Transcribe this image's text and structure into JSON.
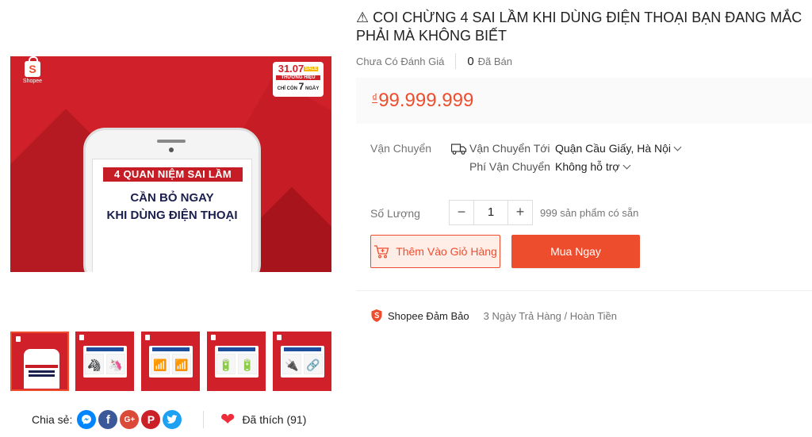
{
  "product": {
    "title": "⚠ COI CHỪNG 4 SAI LẦM KHI DÙNG ĐIỆN THOẠI BẠN ĐANG MẮC PHẢI MÀ KHÔNG BIẾT",
    "rating_text": "Chưa Có Đánh Giá",
    "sold_count": "0",
    "sold_label": "Đã Bán",
    "currency": "₫",
    "price": "99.999.999"
  },
  "image": {
    "logo_label": "Shopee",
    "sale_date": "31.07",
    "sale_tag": "SALE",
    "sale_line1": "THƯƠNG HIỆU",
    "sale_line2": "CHỈ CÒN",
    "sale_days": "7",
    "sale_line3": "NGÀY",
    "headline1": "4 QUAN NIỆM SAI LẦM",
    "headline2": "CẦN BỎ NGAY",
    "headline3": "KHI DÙNG ĐIỆN THOẠI"
  },
  "thumbnails": [
    {
      "icons": [
        "",
        ""
      ],
      "type": "phone"
    },
    {
      "icons": [
        "🦓",
        "🦄"
      ],
      "type": "compare"
    },
    {
      "icons": [
        "📶",
        "📶"
      ],
      "type": "compare"
    },
    {
      "icons": [
        "🔋",
        "🔋"
      ],
      "type": "compare"
    },
    {
      "icons": [
        "🔌",
        "🔗"
      ],
      "type": "compare"
    }
  ],
  "shipping": {
    "label": "Vận Chuyển",
    "to_label": "Vận Chuyển Tới",
    "to_value": "Quận Cầu Giấy, Hà Nội",
    "fee_label": "Phí Vận Chuyển",
    "fee_value": "Không hỗ trợ"
  },
  "quantity": {
    "label": "Số Lượng",
    "minus": "−",
    "value": "1",
    "plus": "+",
    "stock": "999 sản phẩm có sẵn"
  },
  "actions": {
    "add_to_cart": "Thêm Vào Giỏ Hàng",
    "buy_now": "Mua Ngay"
  },
  "guarantee": {
    "title": "Shopee Đảm Bảo",
    "detail": "3 Ngày Trả Hàng / Hoàn Tiền"
  },
  "share": {
    "label": "Chia sẻ:",
    "icons": [
      "messenger-icon",
      "facebook-icon",
      "google-plus-icon",
      "pinterest-icon",
      "twitter-icon"
    ]
  },
  "like": {
    "text": "Đã thích (91)"
  },
  "colors": {
    "accent": "#ee4d2d",
    "banner_red": "#d0202a"
  }
}
